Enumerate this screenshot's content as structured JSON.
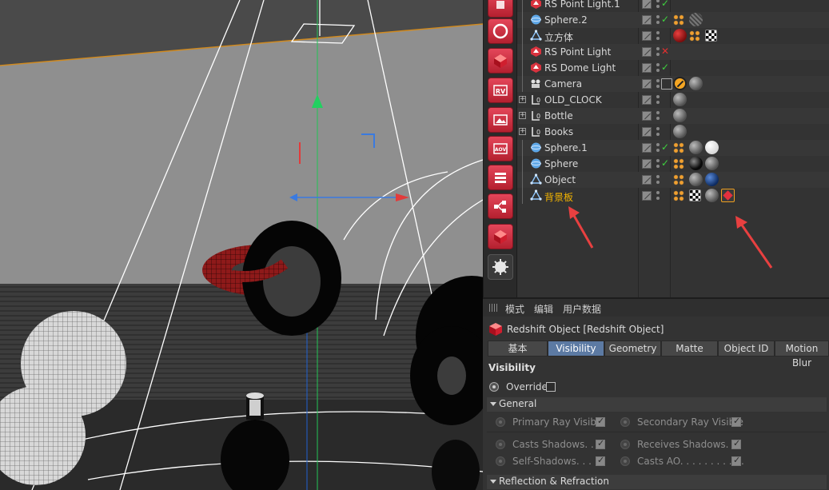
{
  "object_manager": {
    "rows": [
      {
        "name": "RS Point Light.1",
        "icon": "rs-light-icon",
        "status": "check",
        "tags": []
      },
      {
        "name": "Sphere.2",
        "icon": "sphere-icon",
        "status": "check",
        "tags": [
          "phong",
          "noise"
        ]
      },
      {
        "name": "立方体",
        "icon": "polygon-object-icon",
        "status": "",
        "tags": [
          "red",
          "phong",
          "check"
        ]
      },
      {
        "name": "RS Point Light",
        "icon": "rs-light-icon",
        "status": "cross",
        "tags": []
      },
      {
        "name": "RS Dome Light",
        "icon": "rs-light-icon",
        "status": "check",
        "tags": []
      },
      {
        "name": "Camera",
        "icon": "camera-icon",
        "status": "protect",
        "tags": [
          "target",
          "mat"
        ]
      },
      {
        "name": "OLD_CLOCK",
        "icon": "null-object-icon",
        "status": "",
        "tags": [
          "mat"
        ]
      },
      {
        "name": "Bottle",
        "icon": "null-object-icon",
        "status": "",
        "tags": [
          "mat"
        ]
      },
      {
        "name": "Books",
        "icon": "null-object-icon",
        "status": "",
        "tags": [
          "mat"
        ]
      },
      {
        "name": "Sphere.1",
        "icon": "sphere-icon",
        "status": "check",
        "tags": [
          "phong",
          "mat",
          "white"
        ]
      },
      {
        "name": "Sphere",
        "icon": "sphere-icon",
        "status": "check",
        "tags": [
          "phong",
          "black",
          "mat"
        ]
      },
      {
        "name": "Object",
        "icon": "polygon-object-icon",
        "status": "",
        "tags": [
          "phong",
          "mat",
          "blue"
        ]
      },
      {
        "name": "背景板",
        "icon": "polygon-object-icon",
        "status": "",
        "tags": [
          "phong",
          "check",
          "mat",
          "rs"
        ]
      }
    ]
  },
  "attributes": {
    "menu": {
      "mode": "模式",
      "edit": "编辑",
      "user_data": "用户数据"
    },
    "title": "Redshift Object [Redshift Object]",
    "tabs": [
      {
        "label": "基本",
        "active": false
      },
      {
        "label": "Visibility",
        "active": true
      },
      {
        "label": "Geometry",
        "active": false
      },
      {
        "label": "Matte",
        "active": false
      },
      {
        "label": "Object ID",
        "active": false
      },
      {
        "label": "Motion Blur",
        "active": false
      }
    ],
    "section_title": "Visibility",
    "override_label": "Override",
    "general_label": "General",
    "primary_ray": "Primary Ray Visible",
    "secondary_ray": "Secondary Ray Visible",
    "casts_shadows": "Casts Shadows. . . .",
    "receives_shadows": "Receives Shadows. . .",
    "self_shadows": "Self-Shadows. . . . .",
    "casts_ao": "Casts AO. . . . . . . . . . .",
    "reflection_label": "Reflection & Refraction"
  },
  "colors": {
    "accent_tab": "#5c7aa3",
    "highlight_name": "#f3b400",
    "redshift_red": "#e2303e"
  }
}
